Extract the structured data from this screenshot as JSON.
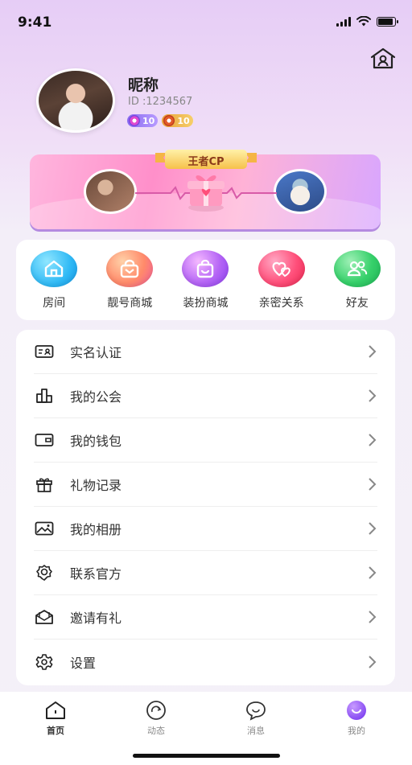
{
  "status_bar": {
    "time": "9:41",
    "battery_level": 0.9
  },
  "profile": {
    "nickname": "昵称",
    "user_id": "ID :1234567",
    "badges": [
      {
        "value": "10",
        "color": "#9a7cf4"
      },
      {
        "value": "10",
        "color": "#eeae48"
      }
    ]
  },
  "banner": {
    "title": "王者CP"
  },
  "shortcuts": [
    {
      "label": "房间",
      "icon": "house-icon",
      "color": "#2fb9f5"
    },
    {
      "label": "靓号商城",
      "icon": "shopping-bag-icon",
      "color": "#ff7a5c"
    },
    {
      "label": "装扮商城",
      "icon": "gift-bag-icon",
      "color": "#b565f5"
    },
    {
      "label": "亲密关系",
      "icon": "hearts-icon",
      "color": "#ff4f7a"
    },
    {
      "label": "好友",
      "icon": "friends-icon",
      "color": "#36d06a"
    }
  ],
  "menu": [
    {
      "label": "实名认证",
      "icon": "id-card-icon"
    },
    {
      "label": "我的公会",
      "icon": "guild-icon"
    },
    {
      "label": "我的钱包",
      "icon": "wallet-icon"
    },
    {
      "label": "礼物记录",
      "icon": "gift-icon"
    },
    {
      "label": "我的相册",
      "icon": "album-icon"
    },
    {
      "label": "联系官方",
      "icon": "support-icon"
    },
    {
      "label": "邀请有礼",
      "icon": "invite-icon"
    },
    {
      "label": "设置",
      "icon": "settings-icon"
    }
  ],
  "tabbar": [
    {
      "label": "首页",
      "icon": "home-icon",
      "active": true
    },
    {
      "label": "动态",
      "icon": "moments-icon",
      "active": false
    },
    {
      "label": "消息",
      "icon": "message-icon",
      "active": false
    },
    {
      "label": "我的",
      "icon": "profile-icon",
      "active": false
    }
  ],
  "colors": {
    "accent": "#8b4ef0",
    "background": "#f4f1f8"
  }
}
